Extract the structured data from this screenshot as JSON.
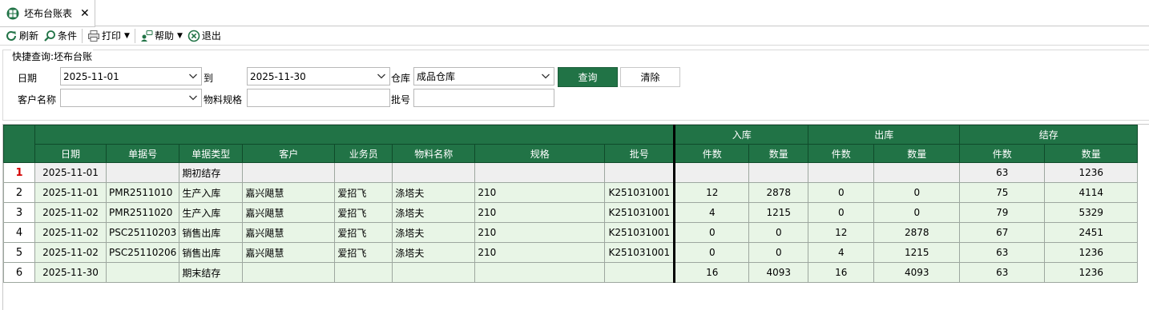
{
  "tab": {
    "title": "坯布台账表",
    "close": "✕"
  },
  "toolbar": {
    "refresh": "刷新",
    "condition": "条件",
    "print": "打印",
    "help": "帮助",
    "exit": "退出"
  },
  "query": {
    "title": "快捷查询:坯布台账",
    "date_label": "日期",
    "date_from": "2025-11-01",
    "to_label": "到",
    "date_to": "2025-11-30",
    "warehouse_label": "仓库",
    "warehouse_value": "成品仓库",
    "search_button": "查询",
    "clear_button": "清除",
    "customer_label": "客户名称",
    "customer_value": "",
    "spec_label": "物料规格",
    "spec_value": "",
    "batch_label": "批号",
    "batch_value": ""
  },
  "grid": {
    "groups": {
      "in": "入库",
      "out": "出库",
      "stock": "结存"
    },
    "columns": {
      "date": "日期",
      "doc_no": "单据号",
      "doc_type": "单据类型",
      "customer": "客户",
      "salesman": "业务员",
      "material": "物料名称",
      "spec": "规格",
      "batch": "批号",
      "in_pcs": "件数",
      "in_qty": "数量",
      "out_pcs": "件数",
      "out_qty": "数量",
      "stock_pcs": "件数",
      "stock_qty": "数量"
    },
    "rows": [
      {
        "n": "1",
        "date": "2025-11-01",
        "doc_no": "",
        "doc_type": "期初结存",
        "customer": "",
        "salesman": "",
        "material": "",
        "spec": "",
        "batch": "",
        "in_pcs": "",
        "in_qty": "",
        "out_pcs": "",
        "out_qty": "",
        "stock_pcs": "63",
        "stock_qty": "1236"
      },
      {
        "n": "2",
        "date": "2025-11-01",
        "doc_no": "PMR2511010",
        "doc_type": "生产入库",
        "customer": "嘉兴飓慧",
        "salesman": "爱招飞",
        "material": "涤塔夫",
        "spec": "210",
        "batch": "K251031001",
        "in_pcs": "12",
        "in_qty": "2878",
        "out_pcs": "0",
        "out_qty": "0",
        "stock_pcs": "75",
        "stock_qty": "4114"
      },
      {
        "n": "3",
        "date": "2025-11-02",
        "doc_no": "PMR2511020",
        "doc_type": "生产入库",
        "customer": "嘉兴飓慧",
        "salesman": "爱招飞",
        "material": "涤塔夫",
        "spec": "210",
        "batch": "K251031001",
        "in_pcs": "4",
        "in_qty": "1215",
        "out_pcs": "0",
        "out_qty": "0",
        "stock_pcs": "79",
        "stock_qty": "5329"
      },
      {
        "n": "4",
        "date": "2025-11-02",
        "doc_no": "PSC25110203",
        "doc_type": "销售出库",
        "customer": "嘉兴飓慧",
        "salesman": "爱招飞",
        "material": "涤塔夫",
        "spec": "210",
        "batch": "K251031001",
        "in_pcs": "0",
        "in_qty": "0",
        "out_pcs": "12",
        "out_qty": "2878",
        "stock_pcs": "67",
        "stock_qty": "2451"
      },
      {
        "n": "5",
        "date": "2025-11-02",
        "doc_no": "PSC25110206",
        "doc_type": "销售出库",
        "customer": "嘉兴飓慧",
        "salesman": "爱招飞",
        "material": "涤塔夫",
        "spec": "210",
        "batch": "K251031001",
        "in_pcs": "0",
        "in_qty": "0",
        "out_pcs": "4",
        "out_qty": "1215",
        "stock_pcs": "63",
        "stock_qty": "1236"
      },
      {
        "n": "6",
        "date": "2025-11-30",
        "doc_no": "",
        "doc_type": "期末结存",
        "customer": "",
        "salesman": "",
        "material": "",
        "spec": "",
        "batch": "",
        "in_pcs": "16",
        "in_qty": "4093",
        "out_pcs": "16",
        "out_qty": "4093",
        "stock_pcs": "63",
        "stock_qty": "1236"
      }
    ]
  },
  "colors": {
    "accent": "#217346",
    "row_green": "#e8f5e6",
    "row_grey": "#efefef",
    "active_row_number": "#d40000"
  }
}
